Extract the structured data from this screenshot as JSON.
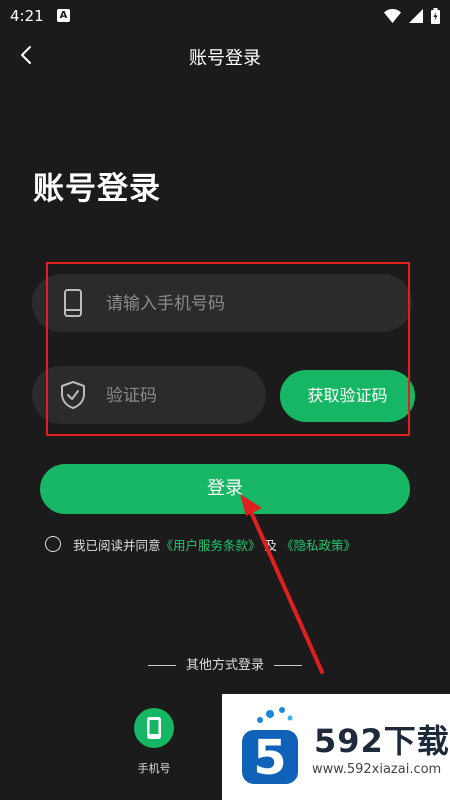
{
  "status_bar": {
    "time": "4:21",
    "notification_badge": "A",
    "icons": [
      "wifi-icon",
      "signal-icon",
      "battery-icon"
    ]
  },
  "header": {
    "title": "账号登录",
    "back_icon": "chevron-left-icon"
  },
  "page_title": "账号登录",
  "phone_field": {
    "placeholder": "请输入手机号码",
    "value": "",
    "icon": "phone-icon"
  },
  "code_field": {
    "placeholder": "验证码",
    "value": "",
    "icon": "shield-icon"
  },
  "get_code_button": "获取验证码",
  "login_button": "登录",
  "agreement": {
    "checked": false,
    "prefix": "我已阅读并同意",
    "terms_link": "《用户服务条款》",
    "and": "及",
    "privacy_link": "《隐私政策》"
  },
  "other_login": {
    "title": "其他方式登录",
    "methods": [
      {
        "label": "手机号",
        "icon": "mobile-phone-icon"
      }
    ]
  },
  "watermark": {
    "brand": "592下载",
    "url": "www.592xiazai.com",
    "logo": "5"
  },
  "colors": {
    "background": "#1b1b1b",
    "accent": "#17b765",
    "field": "#2b2b2b",
    "highlight": "#e02020"
  }
}
